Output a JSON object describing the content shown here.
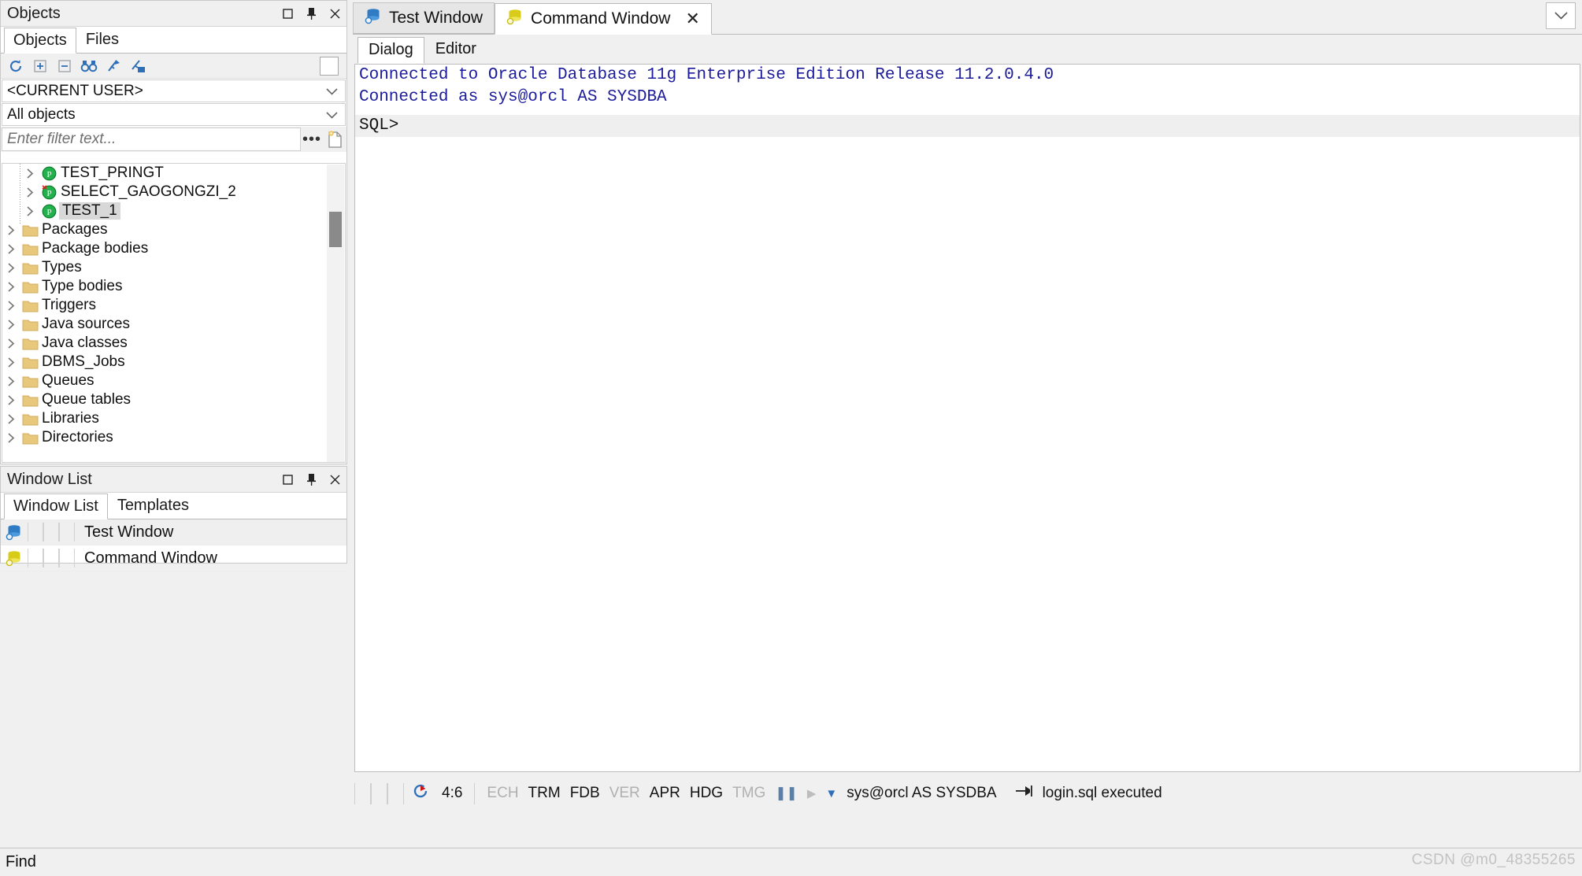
{
  "objects_panel": {
    "title": "Objects",
    "header_buttons": [
      {
        "name": "maximize",
        "glyph": "square"
      },
      {
        "name": "pin",
        "glyph": "pin"
      },
      {
        "name": "close",
        "glyph": "x"
      }
    ],
    "tabs": [
      {
        "label": "Objects",
        "active": true
      },
      {
        "label": "Files",
        "active": false
      }
    ],
    "toolbar_icons": [
      "refresh-icon",
      "expand-all-icon",
      "collapse-all-icon",
      "find-icon",
      "tree-filter-icon",
      "folder-tree-icon"
    ],
    "user_combo": "<CURRENT USER>",
    "filter_combo": "All objects",
    "filter_placeholder": "Enter filter text...",
    "ellipsis_label": "•••",
    "tree": [
      {
        "label": "TEST_PRINGT",
        "icon": "procedure-icon",
        "indent": 1,
        "selected": false,
        "error": false
      },
      {
        "label": "SELECT_GAOGONGZI_2",
        "icon": "procedure-icon",
        "indent": 1,
        "selected": false,
        "error": true
      },
      {
        "label": "TEST_1",
        "icon": "procedure-icon",
        "indent": 1,
        "selected": true,
        "error": false
      },
      {
        "label": "Packages",
        "icon": "folder-icon",
        "indent": 0,
        "selected": false,
        "error": false
      },
      {
        "label": "Package bodies",
        "icon": "folder-icon",
        "indent": 0,
        "selected": false,
        "error": false
      },
      {
        "label": "Types",
        "icon": "folder-icon",
        "indent": 0,
        "selected": false,
        "error": false
      },
      {
        "label": "Type bodies",
        "icon": "folder-icon",
        "indent": 0,
        "selected": false,
        "error": false
      },
      {
        "label": "Triggers",
        "icon": "folder-icon",
        "indent": 0,
        "selected": false,
        "error": false
      },
      {
        "label": "Java sources",
        "icon": "folder-icon",
        "indent": 0,
        "selected": false,
        "error": false
      },
      {
        "label": "Java classes",
        "icon": "folder-icon",
        "indent": 0,
        "selected": false,
        "error": false
      },
      {
        "label": "DBMS_Jobs",
        "icon": "folder-icon",
        "indent": 0,
        "selected": false,
        "error": false
      },
      {
        "label": "Queues",
        "icon": "folder-icon",
        "indent": 0,
        "selected": false,
        "error": false
      },
      {
        "label": "Queue tables",
        "icon": "folder-icon",
        "indent": 0,
        "selected": false,
        "error": false
      },
      {
        "label": "Libraries",
        "icon": "folder-icon",
        "indent": 0,
        "selected": false,
        "error": false
      },
      {
        "label": "Directories",
        "icon": "folder-icon",
        "indent": 0,
        "selected": false,
        "error": false
      }
    ]
  },
  "window_list_panel": {
    "title": "Window List",
    "tabs": [
      {
        "label": "Window List",
        "active": true
      },
      {
        "label": "Templates",
        "active": false
      }
    ],
    "rows": [
      {
        "label": "Test Window",
        "icon": "db-blue-icon",
        "selected": true
      },
      {
        "label": "Command Window",
        "icon": "db-yellow-icon",
        "selected": false
      }
    ]
  },
  "main": {
    "tabs": [
      {
        "label": "Test Window",
        "icon": "db-blue-icon",
        "active": false,
        "closable": false
      },
      {
        "label": "Command Window",
        "icon": "db-yellow-icon",
        "active": true,
        "closable": true
      }
    ],
    "close_glyph": "✕",
    "sub_tabs": [
      {
        "label": "Dialog",
        "active": true
      },
      {
        "label": "Editor",
        "active": false
      }
    ],
    "console": {
      "lines": [
        "Connected to Oracle Database 11g Enterprise Edition Release 11.2.0.4.0",
        "Connected as sys@orcl AS SYSDBA"
      ],
      "prompt": "SQL>"
    },
    "status_bar": {
      "cursor_position": "4:6",
      "indicators": [
        {
          "label": "ECH",
          "enabled": false
        },
        {
          "label": "TRM",
          "enabled": true
        },
        {
          "label": "FDB",
          "enabled": true
        },
        {
          "label": "VER",
          "enabled": false
        },
        {
          "label": "APR",
          "enabled": true
        },
        {
          "label": "HDG",
          "enabled": true
        },
        {
          "label": "TMG",
          "enabled": false
        }
      ],
      "pause_glyph": "❚❚",
      "play_glyph": "▶",
      "dropdown_glyph": "▼",
      "connection": "sys@orcl AS SYSDBA",
      "script_status": "login.sql executed"
    }
  },
  "find_bar": {
    "label": "Find"
  },
  "watermark": "CSDN @m0_48355265",
  "colors": {
    "accent_blue": "#2e6fb7",
    "console_text": "#1b1b9b",
    "folder": "#e8c87d",
    "proc_green": "#22b14c",
    "db_blue": "#2f7cc4",
    "db_yellow": "#e0d41a"
  }
}
